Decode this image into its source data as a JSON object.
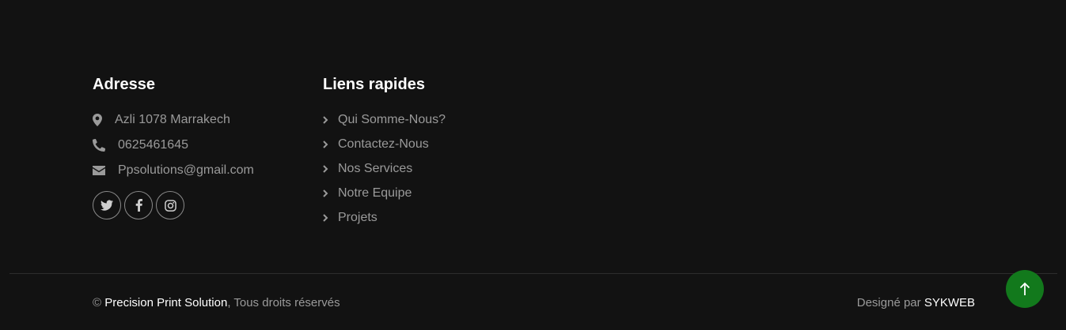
{
  "colors": {
    "background": "#121212",
    "heading": "#ffffff",
    "text": "#9a9a9a",
    "accent": "#12791c"
  },
  "address": {
    "title": "Adresse",
    "items": [
      {
        "icon": "map-marker-icon",
        "text": "Azli 1078 Marrakech"
      },
      {
        "icon": "phone-icon",
        "text": "0625461645"
      },
      {
        "icon": "envelope-icon",
        "text": "Ppsolutions@gmail.com"
      }
    ],
    "socials": [
      {
        "icon": "twitter-icon"
      },
      {
        "icon": "facebook-icon"
      },
      {
        "icon": "instagram-icon"
      }
    ]
  },
  "quick_links": {
    "title": "Liens rapides",
    "items": [
      {
        "label": "Qui Somme-Nous?"
      },
      {
        "label": "Contactez-Nous"
      },
      {
        "label": "Nos Services"
      },
      {
        "label": "Notre Equipe"
      },
      {
        "label": "Projets"
      }
    ]
  },
  "bottom": {
    "copyright_symbol": "©",
    "brand": "Precision Print Solution",
    "rights": ", Tous droits réservés",
    "designed_prefix": "Designé par ",
    "designer": "SYKWEB"
  },
  "back_to_top": {
    "icon": "arrow-up-icon"
  }
}
